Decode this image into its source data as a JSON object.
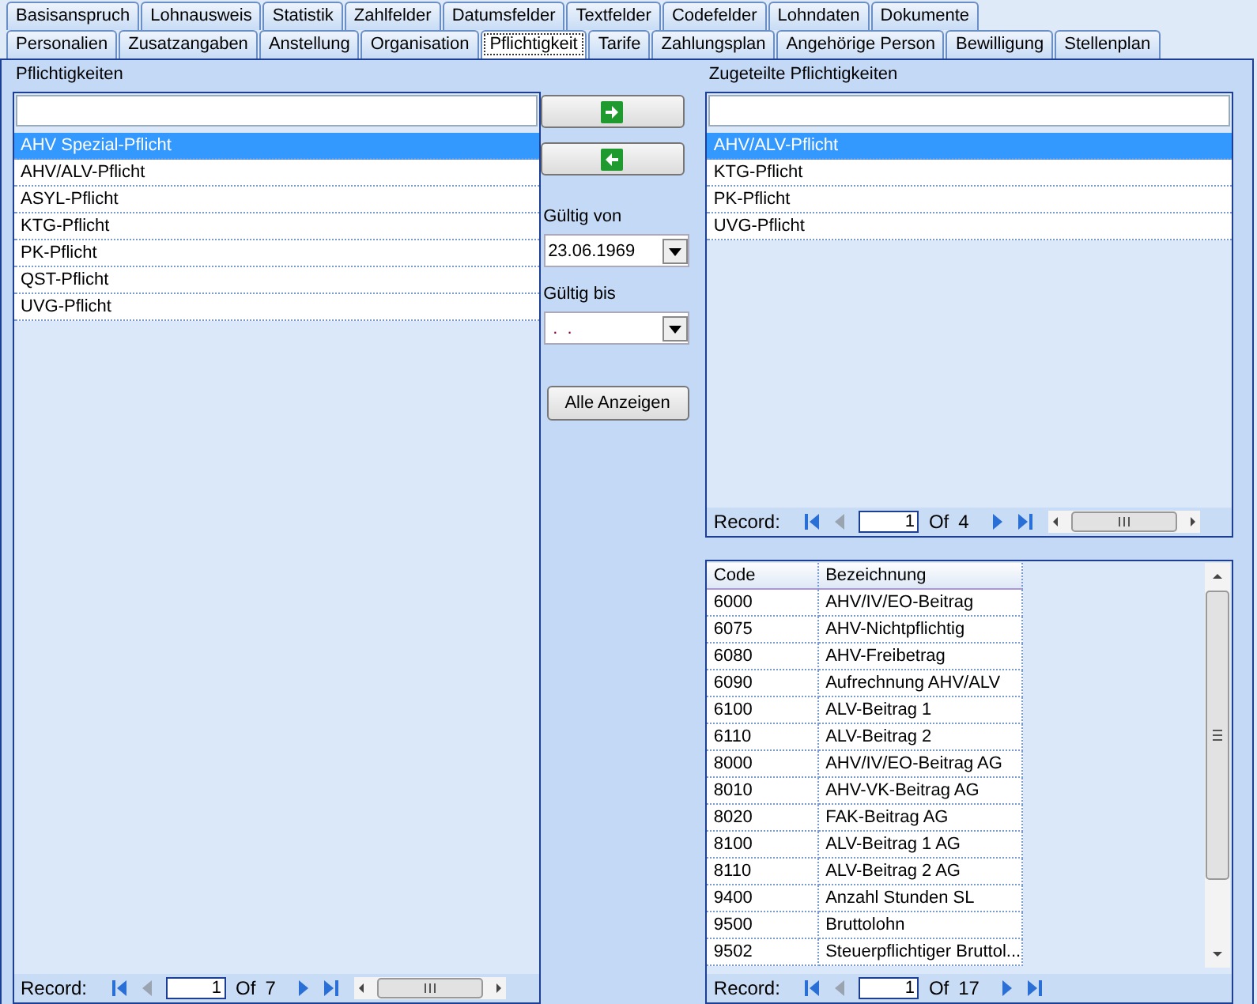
{
  "tab_rows": [
    [
      {
        "label": "Basisanspruch",
        "selected": false
      },
      {
        "label": "Lohnausweis",
        "selected": false
      },
      {
        "label": "Statistik",
        "selected": false
      },
      {
        "label": "Zahlfelder",
        "selected": false
      },
      {
        "label": "Datumsfelder",
        "selected": false
      },
      {
        "label": "Textfelder",
        "selected": false
      },
      {
        "label": "Codefelder",
        "selected": false
      },
      {
        "label": "Lohndaten",
        "selected": false
      },
      {
        "label": "Dokumente",
        "selected": false
      }
    ],
    [
      {
        "label": "Personalien",
        "selected": false
      },
      {
        "label": "Zusatzangaben",
        "selected": false
      },
      {
        "label": "Anstellung",
        "selected": false
      },
      {
        "label": "Organisation",
        "selected": false
      },
      {
        "label": "Pflichtigkeit",
        "selected": true
      },
      {
        "label": "Tarife",
        "selected": false
      },
      {
        "label": "Zahlungsplan",
        "selected": false
      },
      {
        "label": "Angehörige Person",
        "selected": false
      },
      {
        "label": "Bewilligung",
        "selected": false
      },
      {
        "label": "Stellenplan",
        "selected": false
      }
    ]
  ],
  "available": {
    "title": "Pflichtigkeiten",
    "items": [
      {
        "label": "AHV Spezial-Pflicht",
        "selected": true
      },
      {
        "label": "AHV/ALV-Pflicht",
        "selected": false
      },
      {
        "label": "ASYL-Pflicht",
        "selected": false
      },
      {
        "label": "KTG-Pflicht",
        "selected": false
      },
      {
        "label": "PK-Pflicht",
        "selected": false
      },
      {
        "label": "QST-Pflicht",
        "selected": false
      },
      {
        "label": "UVG-Pflicht",
        "selected": false
      }
    ],
    "navigator": {
      "label": "Record:",
      "current": "1",
      "of": "Of",
      "total": "7",
      "hscroll": true
    }
  },
  "middle": {
    "valid_from_label": "Gültig von",
    "valid_from": "23.06.1969",
    "valid_to_label": "Gültig bis",
    "valid_to": " .  .",
    "show_all_button": "Alle Anzeigen"
  },
  "assigned": {
    "title": "Zugeteilte Pflichtigkeiten",
    "items": [
      {
        "label": "AHV/ALV-Pflicht",
        "selected": true
      },
      {
        "label": "KTG-Pflicht",
        "selected": false
      },
      {
        "label": "PK-Pflicht",
        "selected": false
      },
      {
        "label": "UVG-Pflicht",
        "selected": false
      }
    ],
    "navigator": {
      "label": "Record:",
      "current": "1",
      "of": "Of",
      "total": "4",
      "hscroll": true
    }
  },
  "wage_types": {
    "columns": [
      "Code",
      "Bezeichnung"
    ],
    "rows": [
      [
        "6000",
        "AHV/IV/EO-Beitrag"
      ],
      [
        "6075",
        "AHV-Nichtpflichtig"
      ],
      [
        "6080",
        "AHV-Freibetrag"
      ],
      [
        "6090",
        "Aufrechnung AHV/ALV"
      ],
      [
        "6100",
        "ALV-Beitrag 1"
      ],
      [
        "6110",
        "ALV-Beitrag 2"
      ],
      [
        "8000",
        "AHV/IV/EO-Beitrag AG"
      ],
      [
        "8010",
        "AHV-VK-Beitrag AG"
      ],
      [
        "8020",
        "FAK-Beitrag AG"
      ],
      [
        "8100",
        "ALV-Beitrag 1 AG"
      ],
      [
        "8110",
        "ALV-Beitrag 2 AG"
      ],
      [
        "9400",
        "Anzahl Stunden SL"
      ],
      [
        "9500",
        "Bruttolohn"
      ],
      [
        "9502",
        "Steuerpflichtiger Bruttol..."
      ]
    ],
    "navigator": {
      "label": "Record:",
      "current": "1",
      "of": "Of",
      "total": "17",
      "hscroll": false
    }
  }
}
